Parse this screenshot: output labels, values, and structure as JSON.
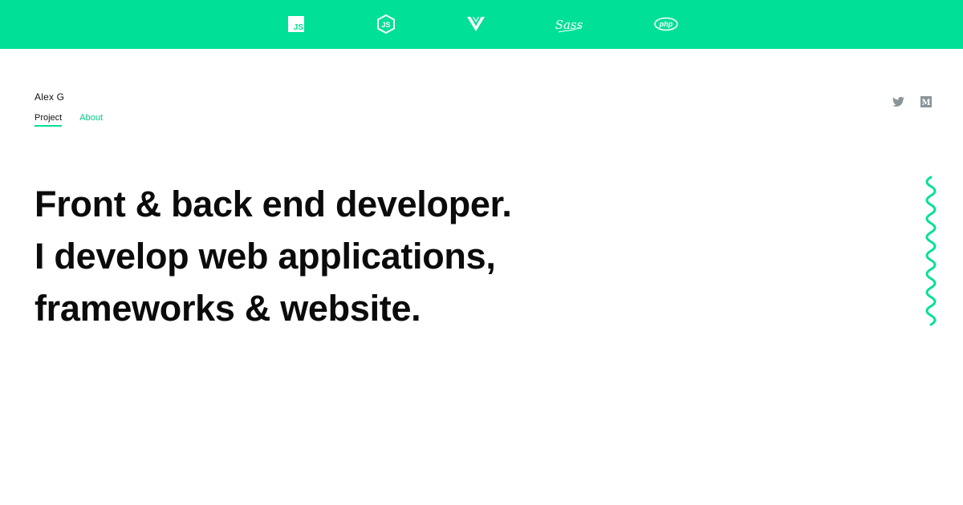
{
  "colors": {
    "accent": "#00e096",
    "accent_text": "#00c987",
    "text": "#111111",
    "social_icon": "#8a9499"
  },
  "topbar": {
    "icons": [
      "js-icon",
      "nodejs-icon",
      "vue-icon",
      "sass-icon",
      "php-icon"
    ],
    "js_label": "JS",
    "node_label": "JS",
    "sass_label": "Sass",
    "php_label": "php"
  },
  "header": {
    "brand": "Alex G",
    "nav": [
      {
        "label": "Project",
        "active": true
      },
      {
        "label": "About",
        "active": false
      }
    ],
    "social_icons": [
      "twitter-icon",
      "medium-icon"
    ],
    "medium_label": "M"
  },
  "hero": {
    "lines": [
      "Front & back end developer.",
      "I develop web applications,",
      "frameworks & website."
    ]
  }
}
